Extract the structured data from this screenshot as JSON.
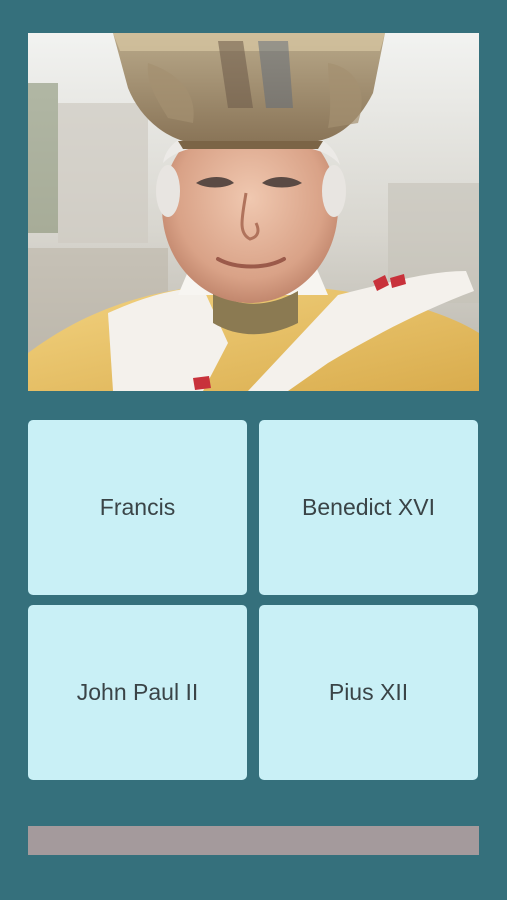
{
  "quiz": {
    "image_subject": "pope-portrait",
    "answers": [
      {
        "label": "Francis"
      },
      {
        "label": "Benedict XVI"
      },
      {
        "label": "John Paul II"
      },
      {
        "label": "Pius XII"
      }
    ]
  },
  "progress": {
    "value": 0
  },
  "colors": {
    "background": "#35707c",
    "answer_button": "#c9f0f6",
    "answer_text": "#3a4447",
    "progress_track": "#a49a9c"
  }
}
